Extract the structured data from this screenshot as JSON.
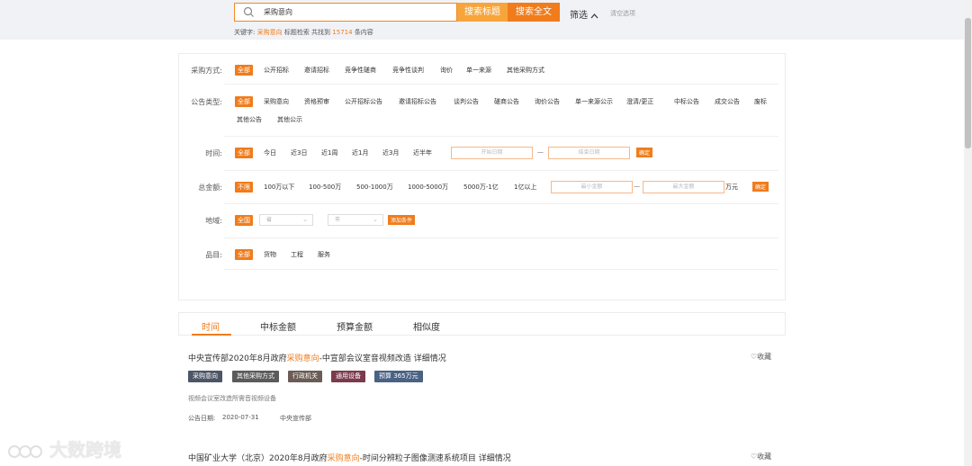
{
  "search": {
    "value": "采购意向",
    "btn_title": "搜索标题",
    "btn_full": "搜索全文",
    "filter_label": "筛选",
    "clear_label": "清空选项",
    "summary_prefix": "关键字:",
    "summary_keyword": "采购意向",
    "summary_mid": "标题检索 共找到",
    "summary_count": "15714",
    "summary_suffix": "条内容"
  },
  "filters": {
    "method": {
      "label": "采购方式:",
      "options": [
        "全部",
        "公开招标",
        "邀请招标",
        "竞争性磋商",
        "竞争性谈判",
        "询价",
        "单一来源",
        "其他采购方式"
      ]
    },
    "type": {
      "label": "公告类型:",
      "options": [
        "全部",
        "采购意向",
        "资格预审",
        "公开招标公告",
        "邀请招标公告",
        "谈判公告",
        "磋商公告",
        "询价公告",
        "单一来源公示",
        "澄清/更正",
        "中标公告",
        "成交公告",
        "废标",
        "其他公告",
        "其他公示"
      ]
    },
    "time": {
      "label": "时间:",
      "options": [
        "全部",
        "今日",
        "近3日",
        "近1周",
        "近1月",
        "近3月",
        "近半年"
      ],
      "start_placeholder": "开始日期",
      "end_placeholder": "结束日期",
      "ok": "确定"
    },
    "amount": {
      "label": "总金额:",
      "options": [
        "不限",
        "100万以下",
        "100-500万",
        "500-1000万",
        "1000-5000万",
        "5000万-1亿",
        "1亿以上"
      ],
      "min_placeholder": "最小金额",
      "max_placeholder": "最大金额",
      "unit": "万元",
      "ok": "确定"
    },
    "region": {
      "label": "地域:",
      "all": "全国",
      "province": "省",
      "city": "市",
      "add": "添加条件"
    },
    "category": {
      "label": "品目:",
      "options": [
        "全部",
        "货物",
        "工程",
        "服务"
      ]
    }
  },
  "sort_tabs": [
    "时间",
    "中标金额",
    "预算金额",
    "相似度"
  ],
  "results": [
    {
      "title_pre": "中央宣传部2020年8月政府",
      "title_hl": "采购意向",
      "title_post": "-中宣部会议室音视频改造 详细情况",
      "fav": "收藏",
      "tags": [
        {
          "text": "采购意向",
          "color": "#4d5666"
        },
        {
          "text": "其他采购方式",
          "color": "#5b5b5b"
        },
        {
          "text": "行政机关",
          "color": "#6b5d55"
        },
        {
          "text": "通用设备",
          "color": "#7a3b4d"
        },
        {
          "text": "预算 365万元",
          "color": "#4a6283"
        }
      ],
      "desc": "视频会议室改造所需音视频设备",
      "date_label": "公告日期:",
      "date": "2020-07-31",
      "org": "中央宣传部"
    },
    {
      "title_pre": "中国矿业大学（北京）2020年8月政府",
      "title_hl": "采购意向",
      "title_post": "-时间分辨粒子图像测速系统项目 详细情况",
      "fav": "收藏"
    }
  ],
  "watermark": "大数跨境",
  "colors": {
    "accent": "#f07c1c",
    "accent_light": "#f7a53b"
  }
}
